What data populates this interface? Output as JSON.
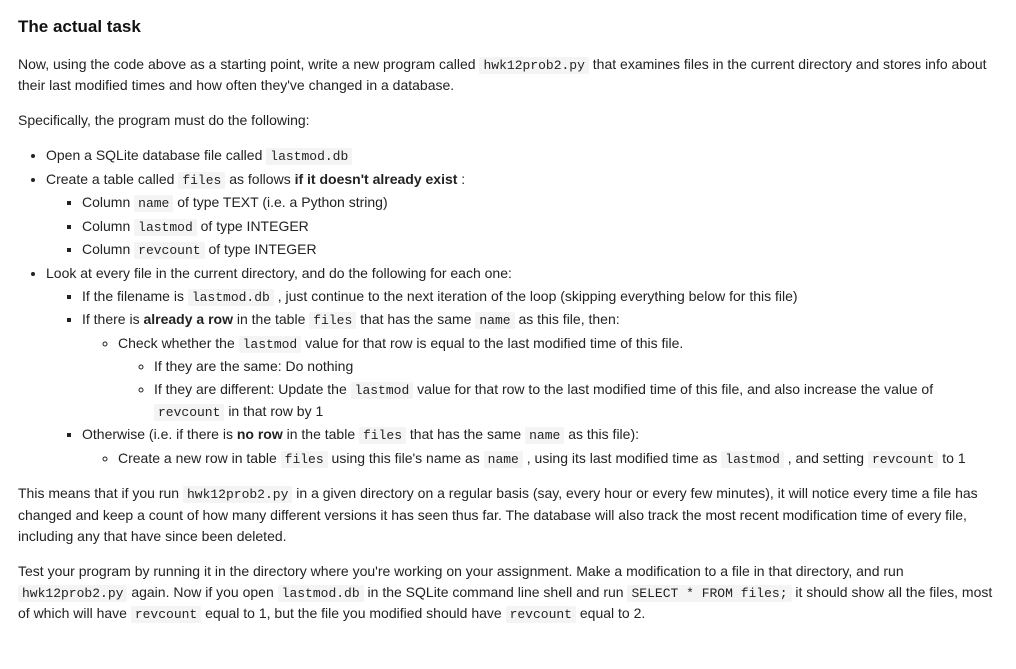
{
  "heading": "The actual task",
  "intro": {
    "t1": "Now, using the code above as a starting point, write a new program called ",
    "code1": "hwk12prob2.py",
    "t2": " that examines files in the current directory and stores info about their last modified times and how often they've changed in a database."
  },
  "specifically": "Specifically, the program must do the following:",
  "list": {
    "open": {
      "t1": "Open a SQLite database file called ",
      "code1": "lastmod.db"
    },
    "create": {
      "t1": "Create a table called ",
      "code1": "files",
      "t2": " as follows ",
      "strong1": "if it doesn't already exist",
      "t3": ":"
    },
    "col_name": {
      "t1": "Column ",
      "code1": "name",
      "t2": " of type TEXT (i.e. a Python string)"
    },
    "col_lastmod": {
      "t1": "Column ",
      "code1": "lastmod",
      "t2": " of type INTEGER"
    },
    "col_revcount": {
      "t1": "Column ",
      "code1": "revcount",
      "t2": " of type INTEGER"
    },
    "look": {
      "t1": "Look at every file in the current directory, and do the following for each one:"
    },
    "skip": {
      "t1": "If the filename is ",
      "code1": "lastmod.db",
      "t2": ", just continue to the next iteration of the loop (skipping everything below for this file)"
    },
    "already": {
      "t1": "If there is ",
      "strong1": "already a row",
      "t2": " in the table ",
      "code1": "files",
      "t3": " that has the same ",
      "code2": "name",
      "t4": " as this file, then:"
    },
    "check": {
      "t1": "Check whether the ",
      "code1": "lastmod",
      "t2": " value for that row is equal to the last modified time of this file."
    },
    "same": {
      "t1": "If they are the same: Do nothing"
    },
    "diff": {
      "t1": "If they are different: Update the ",
      "code1": "lastmod",
      "t2": " value for that row to the last modified time of this file, and also increase the value of ",
      "code2": "revcount",
      "t3": " in that row by 1"
    },
    "otherwise": {
      "t1": "Otherwise (i.e. if there is ",
      "strong1": "no row",
      "t2": " in the table ",
      "code1": "files",
      "t3": " that has the same ",
      "code2": "name",
      "t4": " as this file):"
    },
    "createrow": {
      "t1": "Create a new row in table ",
      "code1": "files",
      "t2": " using this file's name as ",
      "code2": "name",
      "t3": ", using its last modified time as ",
      "code3": "lastmod",
      "t4": ", and setting ",
      "code4": "revcount",
      "t5": " to 1"
    }
  },
  "means": {
    "t1": "This means that if you run ",
    "code1": "hwk12prob2.py",
    "t2": " in a given directory on a regular basis (say, every hour or every few minutes), it will notice every time a file has changed and keep a count of how many different versions it has seen thus far. The database will also track the most recent modification time of every file, including any that have since been deleted."
  },
  "test": {
    "t1": "Test your program by running it in the directory where you're working on your assignment. Make a modification to a file in that directory, and run ",
    "code1": "hwk12prob2.py",
    "t2": " again. Now if you open ",
    "code2": "lastmod.db",
    "t3": " in the SQLite command line shell and run ",
    "code3": "SELECT * FROM files;",
    "t4": " it should show all the files, most of which will have ",
    "code4": "revcount",
    "t5": " equal to 1, but the file you modified should have ",
    "code5": "revcount",
    "t6": " equal to 2."
  }
}
